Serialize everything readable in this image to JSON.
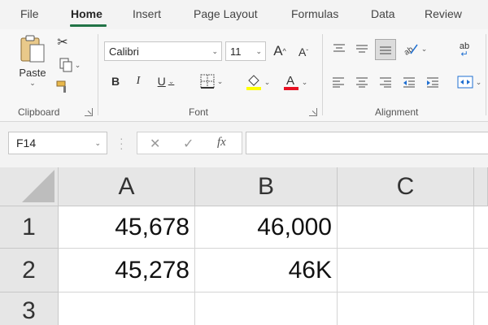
{
  "tabs": [
    "File",
    "Home",
    "Insert",
    "Page Layout",
    "Formulas",
    "Data",
    "Review"
  ],
  "active_tab": "Home",
  "clipboard": {
    "paste_label": "Paste",
    "group_label": "Clipboard"
  },
  "font": {
    "family": "Calibri",
    "size": "11",
    "bold": "B",
    "italic": "I",
    "underline": "U",
    "grow": "A",
    "shrink": "A",
    "group_label": "Font"
  },
  "alignment": {
    "group_label": "Alignment",
    "wrap_label": "ab"
  },
  "formula_bar": {
    "name_box": "F14",
    "fx_label": "fx"
  },
  "columns": [
    "A",
    "B",
    "C"
  ],
  "rows": [
    {
      "num": "1",
      "cells": [
        "45,678",
        "46,000",
        ""
      ]
    },
    {
      "num": "2",
      "cells": [
        "45,278",
        "46K",
        ""
      ]
    },
    {
      "num": "3",
      "cells": [
        "",
        "",
        ""
      ]
    }
  ],
  "colors": {
    "accent": "#217346",
    "highlight": "#ffff00",
    "font_color": "#e81123"
  }
}
